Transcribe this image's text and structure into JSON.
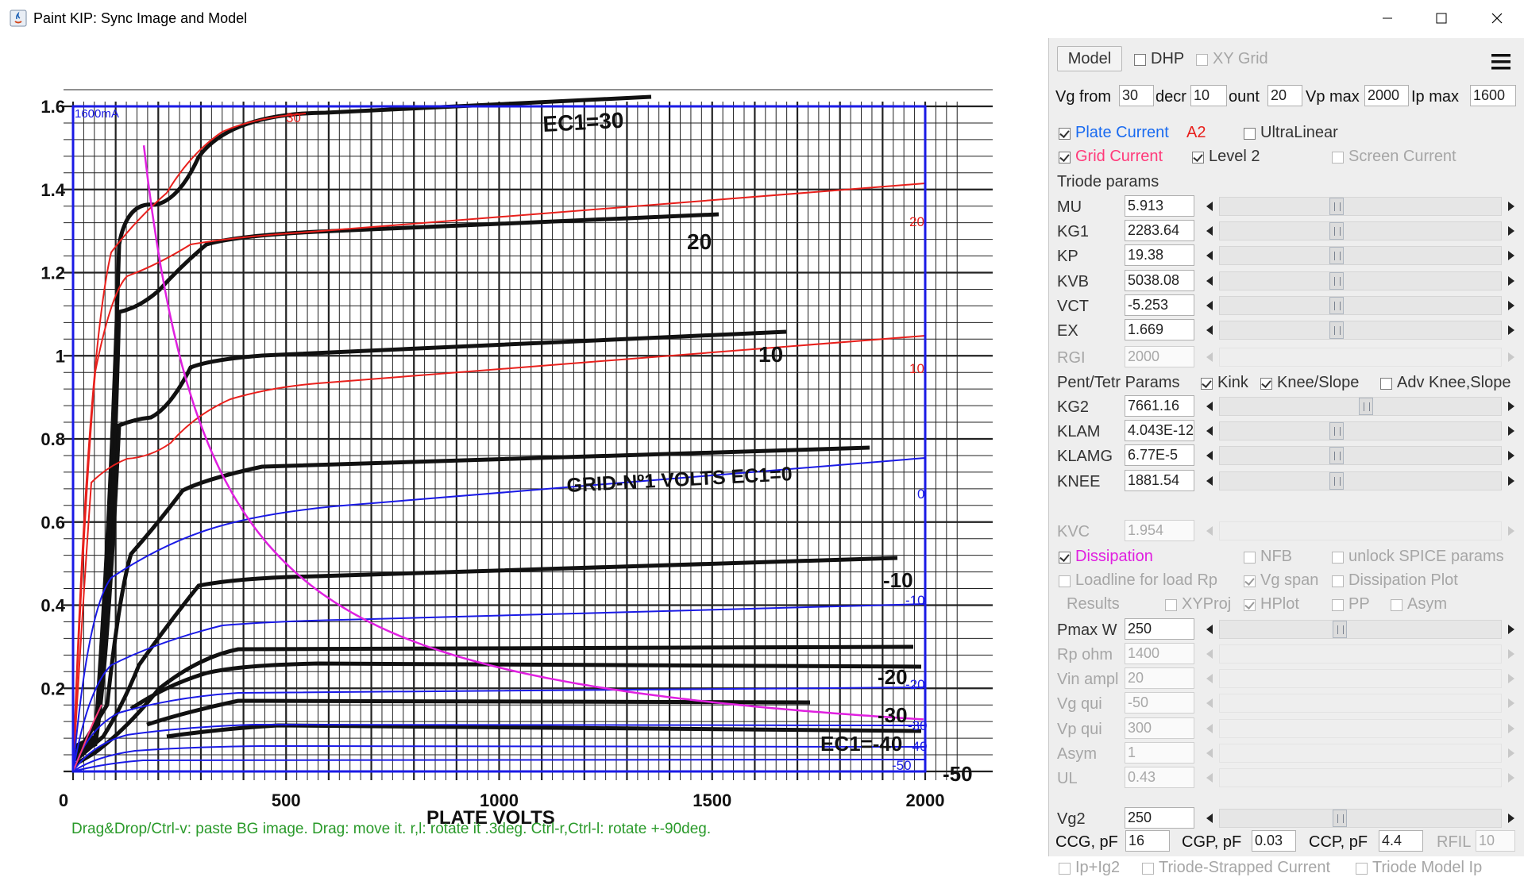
{
  "window": {
    "title": "Paint KIP: Sync Image and Model"
  },
  "colors": {
    "plate_current": "#1a6bf0",
    "model_curve": "#e8201c",
    "grid_current": "#ff3a7a",
    "dissipation": "#e020e0",
    "plot_frame": "#1a1ae6",
    "hint": "#2a9a2a"
  },
  "plot": {
    "y_ticks": [
      "1.6",
      "1.4",
      "1.2",
      "1",
      "0.8",
      "0.6",
      "0.4",
      "0.2"
    ],
    "x_ticks": [
      "0",
      "500",
      "1000",
      "1500",
      "2000"
    ],
    "top_left_label": "1600mA",
    "hint": "Drag&Drop/Ctrl-v: paste BG image. Drag: move it. r,l: rotate it .3deg. Ctrl-r,Ctrl-l: rotate +-90deg.",
    "bg_labels": {
      "ec1_30": "EC1=30",
      "ec1_20": "20",
      "ec1_10": "10",
      "grid_volts": "GRID-Nº1  VOLTS  EC1=0",
      "m10": "-10",
      "m20": "-20",
      "m30": "-30",
      "m40": "EC1=-40",
      "m50": "-50",
      "plate_volts": "PLATE  VOLTS"
    },
    "model_labels": {
      "r30": "30",
      "r20": "20",
      "r10": "10",
      "b0": "0",
      "bm10": "-10",
      "bm20": "-20",
      "bm30": "-30",
      "bm40": "-40",
      "bm50": "-50"
    }
  },
  "panel": {
    "model_btn": "Model",
    "dhp": "DHP",
    "xy_grid": "XY Grid",
    "vg_from_label": "Vg from",
    "vg_from": "30",
    "decr_label": "decr",
    "decr": "10",
    "count_label": "ount",
    "count": "20",
    "vp_max_label": "Vp max",
    "vp_max": "2000",
    "ip_max_label": "Ip max",
    "ip_max": "1600",
    "plate_current": "Plate Current",
    "a2": "A2",
    "ultralinear": "UltraLinear",
    "grid_current": "Grid Current",
    "level2": "Level 2",
    "screen_current": "Screen Current",
    "triode_params": "Triode params",
    "triode": [
      {
        "name": "MU",
        "value": "5.913",
        "pos": 0.41
      },
      {
        "name": "KG1",
        "value": "2283.64",
        "pos": 0.41
      },
      {
        "name": "KP",
        "value": "19.38",
        "pos": 0.41
      },
      {
        "name": "KVB",
        "value": "5038.08",
        "pos": 0.41
      },
      {
        "name": "VCT",
        "value": "-5.253",
        "pos": 0.41
      },
      {
        "name": "EX",
        "value": "1.669",
        "pos": 0.41
      }
    ],
    "rgi": {
      "name": "RGI",
      "value": "2000"
    },
    "pent_params": "Pent/Tetr Params",
    "kink": "Kink",
    "knee_slope": "Knee/Slope",
    "adv_knee": "Adv Knee,Slope",
    "pent": [
      {
        "name": "KG2",
        "value": "7661.16",
        "pos": 0.52
      },
      {
        "name": "KLAM",
        "value": "4.043E-12",
        "pos": 0.41
      },
      {
        "name": "KLAMG",
        "value": "6.77E-5",
        "pos": 0.41
      },
      {
        "name": "KNEE",
        "value": "1881.54",
        "pos": 0.41
      }
    ],
    "kvc": {
      "name": "KVC",
      "value": "1.954"
    },
    "dissipation": "Dissipation",
    "nfb": "NFB",
    "unlock_spice": "unlock SPICE params",
    "loadline": "Loadline for load Rp",
    "vg_span": "Vg span",
    "dissipation_plot": "Dissipation Plot",
    "results": "Results",
    "xyproj": "XYProj",
    "hplot": "HPlot",
    "pp": "PP",
    "asym_cb": "Asym",
    "pmax": {
      "name": "Pmax W",
      "value": "250",
      "pos": 0.41
    },
    "disabled_rows": [
      {
        "name": "Rp ohm",
        "value": "1400"
      },
      {
        "name": "Vin ampl",
        "value": "20"
      },
      {
        "name": "Vg qui",
        "value": "-50"
      },
      {
        "name": "Vp qui",
        "value": "300"
      },
      {
        "name": "Asym",
        "value": "1"
      },
      {
        "name": "UL",
        "value": "0.43"
      }
    ],
    "vg2": {
      "name": "Vg2",
      "value": "250",
      "pos": 0.41
    },
    "ccg_label": "CCG, pF",
    "ccg": "16",
    "cgp_label": "CGP, pF",
    "cgp": "0.03",
    "ccp_label": "CCP, pF",
    "ccp": "4.4",
    "rfil_label": "RFIL",
    "rfil": "10",
    "ip_ig2": "Ip+Ig2",
    "triode_strapped": "Triode-Strapped Current",
    "triode_model_ip": "Triode Model Ip"
  }
}
